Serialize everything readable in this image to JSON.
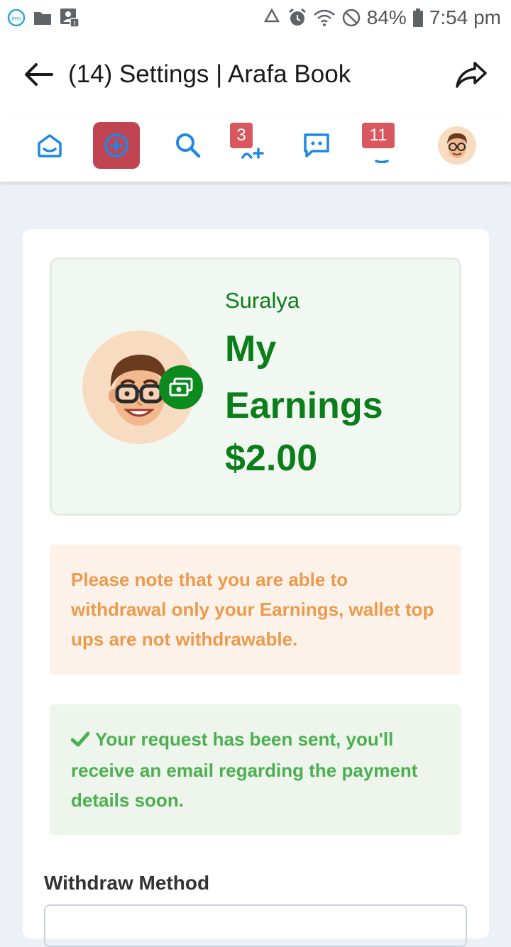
{
  "status_bar": {
    "battery": "84%",
    "time": "7:54 pm",
    "left_icons": [
      "imo-icon",
      "folder-icon",
      "contact-icon"
    ],
    "right_icons": [
      "recycle-icon",
      "alarm-icon",
      "wifi-icon",
      "block-icon",
      "battery-icon"
    ]
  },
  "header": {
    "title": "(14) Settings | Arafa Book"
  },
  "navbar": {
    "friend_requests_count": "3",
    "notifications_count": "11",
    "accent_color": "#1e88e5",
    "create_color": "#c04451"
  },
  "earnings": {
    "username": "Suralya",
    "title": "My Earnings",
    "amount": "$2.00",
    "color": "#0b7d1a"
  },
  "notice": {
    "text": "Please note that you are able to withdrawal only your Earnings, wallet top ups are not withdrawable."
  },
  "success": {
    "text": "Your request has been sent, you'll receive an email regarding the payment details soon."
  },
  "form": {
    "withdraw_method_label": "Withdraw Method"
  }
}
